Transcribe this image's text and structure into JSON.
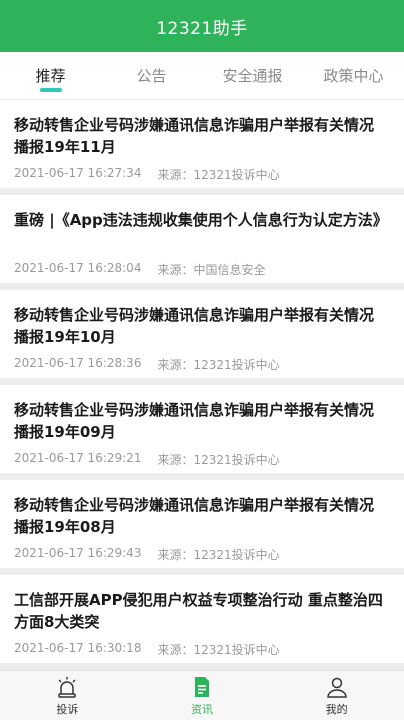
{
  "header": {
    "title": "12321助手"
  },
  "tabs": [
    {
      "label": "推荐"
    },
    {
      "label": "公告"
    },
    {
      "label": "安全通报"
    },
    {
      "label": "政策中心"
    }
  ],
  "articles": [
    {
      "title": "移动转售企业号码涉嫌通讯信息诈骗用户举报有关情况播报19年11月",
      "time": "2021-06-17 16:27:34",
      "source": "来源：12321投诉中心"
    },
    {
      "title": "重磅 |《App违法违规收集使用个人信息行为认定方法》",
      "time": "2021-06-17 16:28:04",
      "source": "来源：中国信息安全"
    },
    {
      "title": "移动转售企业号码涉嫌通讯信息诈骗用户举报有关情况播报19年10月",
      "time": "2021-06-17 16:28:36",
      "source": "来源：12321投诉中心"
    },
    {
      "title": "移动转售企业号码涉嫌通讯信息诈骗用户举报有关情况播报19年09月",
      "time": "2021-06-17 16:29:21",
      "source": "来源：12321投诉中心"
    },
    {
      "title": "移动转售企业号码涉嫌通讯信息诈骗用户举报有关情况播报19年08月",
      "time": "2021-06-17 16:29:43",
      "source": "来源：12321投诉中心"
    },
    {
      "title": "工信部开展APP侵犯用户权益专项整治行动 重点整治四方面8大类突",
      "time": "2021-06-17 16:30:18",
      "source": "来源：12321投诉中心"
    }
  ],
  "bottom_nav": [
    {
      "label": "投诉",
      "icon": "alarm-icon"
    },
    {
      "label": "资讯",
      "icon": "document-icon"
    },
    {
      "label": "我的",
      "icon": "user-icon"
    }
  ],
  "colors": {
    "brand": "#2fb35a",
    "tab_indicator": "#2fc8b4"
  }
}
